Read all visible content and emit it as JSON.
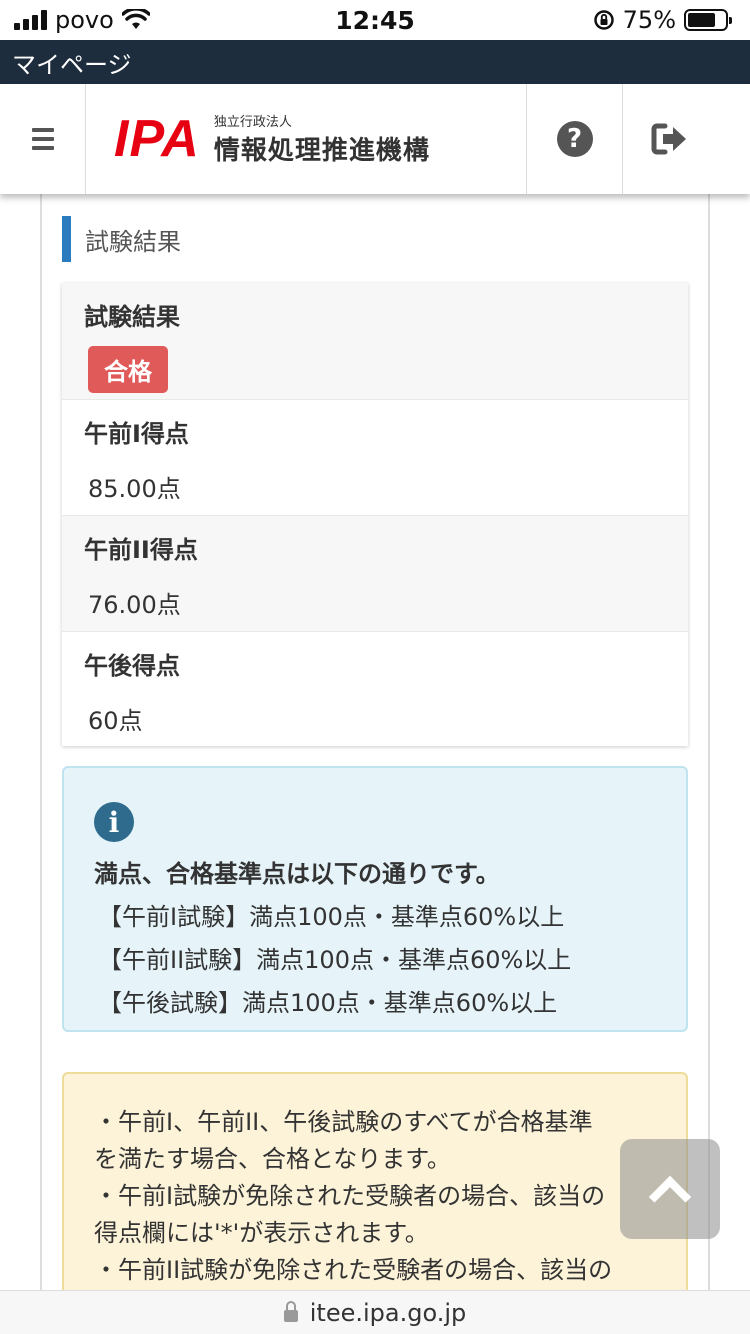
{
  "status_bar": {
    "carrier": "povo",
    "time": "12:45",
    "battery": "75%"
  },
  "page_bar": {
    "title": "マイページ"
  },
  "header": {
    "logo_mark": "IPA",
    "logo_sub": "独立行政法人",
    "logo_main": "情報処理推進機構",
    "help_icon": "?"
  },
  "section": {
    "title": "試験結果"
  },
  "results": {
    "result_label": "試験結果",
    "result_badge": "合格",
    "rows": [
      {
        "label": "午前I得点",
        "value": "85.00点"
      },
      {
        "label": "午前II得点",
        "value": "76.00点"
      },
      {
        "label": "午後得点",
        "value": "60点"
      }
    ]
  },
  "info": {
    "icon": "i",
    "title": "満点、合格基準点は以下の通りです。",
    "lines": [
      "【午前I試験】満点100点・基準点60%以上",
      "【午前II試験】満点100点・基準点60%以上",
      "【午後試験】満点100点・基準点60%以上"
    ]
  },
  "notes": {
    "lines": [
      "・午前I、午前II、午後試験のすべてが合格基準",
      "を満たす場合、合格となります。",
      "・午前I試験が免除された受験者の場合、該当の",
      "得点欄には'*'が表示されます。",
      "・午前II試験が免除された受験者の場合、該当の"
    ]
  },
  "url_bar": {
    "domain": "itee.ipa.go.jp"
  },
  "colors": {
    "accent": "#2b7bbf",
    "pass_badge": "#e05a5a",
    "logo_red": "#e60012",
    "info_bg": "#e6f4fa",
    "note_bg": "#fcf3d8"
  }
}
